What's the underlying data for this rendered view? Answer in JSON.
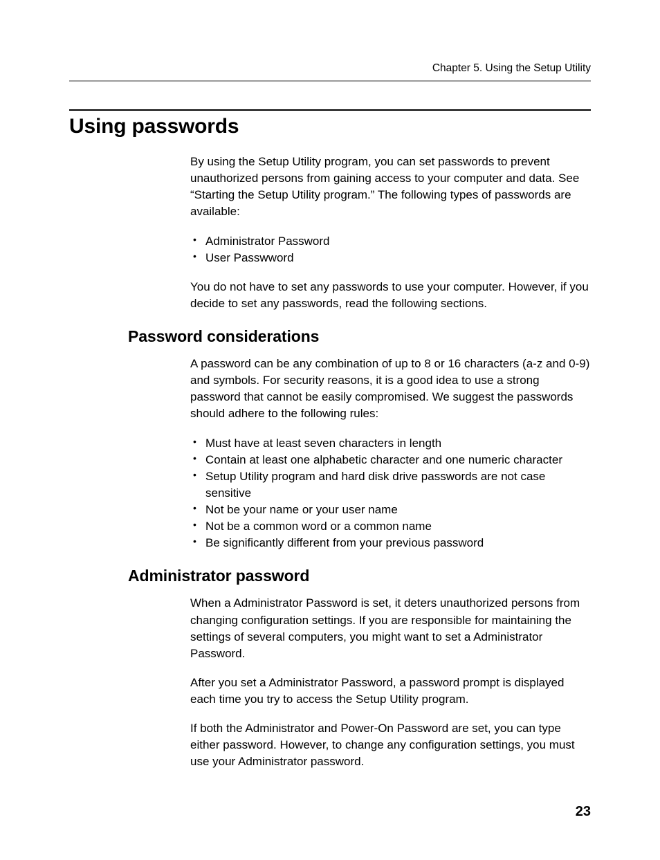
{
  "header": {
    "running": "Chapter 5. Using the Setup Utility"
  },
  "title": "Using passwords",
  "intro": {
    "p1": "By using the Setup Utility program, you can set passwords to prevent unauthorized persons from gaining access to your computer and data. See “Starting the Setup Utility program.” The following types of passwords are available:",
    "list": [
      "Administrator Password",
      "User Passwword"
    ],
    "p2": "You do not have to set any passwords to use your computer. However, if you decide to set any passwords, read the following sections."
  },
  "section1": {
    "heading": "Password considerations",
    "p1": "A password can be any combination of up to 8 or 16 characters (a-z and 0-9) and symbols. For security reasons, it is a good idea to use a strong password that cannot be easily compromised. We suggest the passwords should adhere to the following rules:",
    "list": [
      "Must have at least seven characters in length",
      "Contain at least one alphabetic character and one numeric character",
      "Setup Utility program and hard disk drive passwords are not case sensitive",
      "Not be your name or your user name",
      "Not be a common word or a common name",
      "Be significantly different from your previous password"
    ]
  },
  "section2": {
    "heading": "Administrator password",
    "p1": "When a Administrator Password is set, it deters unauthorized persons from changing configuration settings. If you are responsible for maintaining the settings of several computers, you might want to set a Administrator Password.",
    "p2": "After you set a Administrator Password, a password prompt is displayed each time you try to access the Setup Utility program.",
    "p3": "If both the Administrator and Power-On Password are set, you can type either password. However, to change any configuration settings, you must use your Administrator password."
  },
  "page_number": "23"
}
